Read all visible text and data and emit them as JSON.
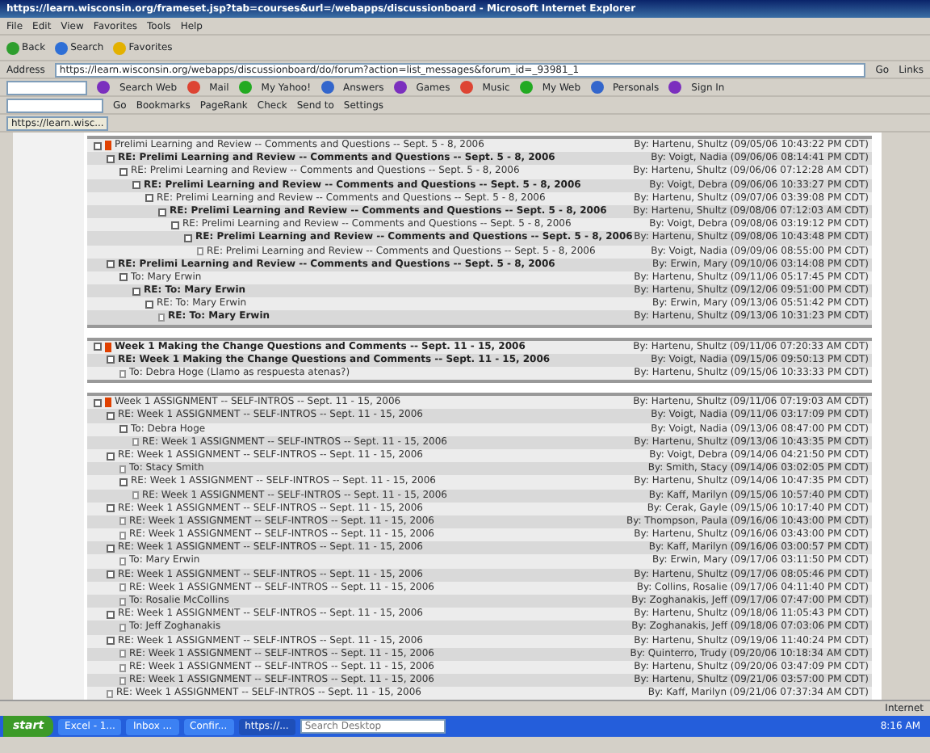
{
  "window": {
    "title": "https://learn.wisconsin.org/frameset.jsp?tab=courses&url=/webapps/discussionboard - Microsoft Internet Explorer"
  },
  "menu": [
    "File",
    "Edit",
    "View",
    "Favorites",
    "Tools",
    "Help"
  ],
  "toolbar": [
    "Back",
    "Search",
    "Favorites"
  ],
  "address": {
    "label": "Address",
    "value": "https://learn.wisconsin.org/webapps/discussionboard/do/forum?action=list_messages&forum_id=_93981_1",
    "go": "Go",
    "links": "Links"
  },
  "yahoo_bar": [
    "Search Web",
    "Mail",
    "My Yahoo!",
    "Answers",
    "Games",
    "Music",
    "My Web",
    "Personals",
    "Sign In"
  ],
  "google_bar": [
    "Go",
    "Bookmarks",
    "PageRank",
    "Check",
    "Send to",
    "Settings"
  ],
  "tab": {
    "label": "https://learn.wisc..."
  },
  "threads": [
    {
      "posts": [
        {
          "title": "Prelimi Learning and Review -- Comments and Questions -- Sept. 5 - 8, 2006",
          "author": "By: Hartenu, Shultz (09/05/06 10:43:22 PM CDT)",
          "flagged": true,
          "unread": false,
          "children": [
            {
              "title": "RE: Prelimi Learning and Review -- Comments and Questions -- Sept. 5 - 8, 2006",
              "author": "By: Voigt, Nadia (09/06/06 08:14:41 PM CDT)",
              "flagged": false,
              "unread": true,
              "children": [
                {
                  "title": "RE: Prelimi Learning and Review -- Comments and Questions -- Sept. 5 - 8, 2006",
                  "author": "By: Hartenu, Shultz (09/06/06 07:12:28 AM CDT)",
                  "flagged": false,
                  "unread": false,
                  "children": [
                    {
                      "title": "RE: Prelimi Learning and Review -- Comments and Questions -- Sept. 5 - 8, 2006",
                      "author": "By: Voigt, Debra (09/06/06 10:33:27 PM CDT)",
                      "flagged": false,
                      "unread": true,
                      "children": [
                        {
                          "title": "RE: Prelimi Learning and Review -- Comments and Questions -- Sept. 5 - 8, 2006",
                          "author": "By: Hartenu, Shultz (09/07/06 03:39:08 PM CDT)",
                          "flagged": false,
                          "unread": false,
                          "children": [
                            {
                              "title": "RE: Prelimi Learning and Review -- Comments and Questions -- Sept. 5 - 8, 2006",
                              "author": "By: Hartenu, Shultz (09/08/06 07:12:03 AM CDT)",
                              "flagged": false,
                              "unread": true,
                              "children": [
                                {
                                  "title": "RE: Prelimi Learning and Review -- Comments and Questions -- Sept. 5 - 8, 2006",
                                  "author": "By: Voigt, Debra (09/08/06 03:19:12 PM CDT)",
                                  "flagged": false,
                                  "unread": false,
                                  "children": [
                                    {
                                      "title": "RE: Prelimi Learning and Review -- Comments and Questions -- Sept. 5 - 8, 2006",
                                      "author": "By: Hartenu, Shultz (09/08/06 10:43:48 PM CDT)",
                                      "flagged": false,
                                      "unread": true,
                                      "children": [
                                        {
                                          "title": "RE: Prelimi Learning and Review -- Comments and Questions -- Sept. 5 - 8, 2006",
                                          "author": "By: Voigt, Nadia (09/09/06 08:55:00 PM CDT)",
                                          "flagged": false,
                                          "unread": false
                                        }
                                      ]
                                    }
                                  ]
                                }
                              ]
                            }
                          ]
                        }
                      ]
                    }
                  ]
                }
              ]
            },
            {
              "title": "RE: Prelimi Learning and Review -- Comments and Questions -- Sept. 5 - 8, 2006",
              "author": "By: Erwin, Mary (09/10/06 03:14:08 PM CDT)",
              "flagged": false,
              "unread": true,
              "children": [
                {
                  "title": "To: Mary Erwin",
                  "author": "By: Hartenu, Shultz (09/11/06 05:17:45 PM CDT)",
                  "flagged": false,
                  "unread": false,
                  "children": [
                    {
                      "title": "RE: To: Mary Erwin",
                      "author": "By: Hartenu, Shultz (09/12/06 09:51:00 PM CDT)",
                      "flagged": false,
                      "unread": true,
                      "children": [
                        {
                          "title": "RE: To: Mary Erwin",
                          "author": "By: Erwin, Mary (09/13/06 05:51:42 PM CDT)",
                          "flagged": false,
                          "unread": false,
                          "children": [
                            {
                              "title": "RE: To: Mary Erwin",
                              "author": "By: Hartenu, Shultz (09/13/06 10:31:23 PM CDT)",
                              "flagged": false,
                              "unread": true
                            }
                          ]
                        }
                      ]
                    }
                  ]
                }
              ]
            }
          ]
        }
      ]
    },
    {
      "posts": [
        {
          "title": "Week 1 Making the Change Questions and Comments -- Sept. 11 - 15, 2006",
          "author": "By: Hartenu, Shultz (09/11/06 07:20:33 AM CDT)",
          "flagged": true,
          "unread": true,
          "children": [
            {
              "title": "RE: Week 1 Making the Change Questions and Comments -- Sept. 11 - 15, 2006",
              "author": "By: Voigt, Nadia (09/15/06 09:50:13 PM CDT)",
              "flagged": false,
              "unread": true,
              "children": [
                {
                  "title": "To: Debra Hoge (Llamo as respuesta atenas?)",
                  "author": "By: Hartenu, Shultz (09/15/06 10:33:33 PM CDT)",
                  "flagged": false,
                  "unread": false
                }
              ]
            }
          ]
        }
      ]
    },
    {
      "posts": [
        {
          "title": "Week 1 ASSIGNMENT -- SELF-INTROS -- Sept. 11 - 15, 2006",
          "author": "By: Hartenu, Shultz (09/11/06 07:19:03 AM CDT)",
          "flagged": true,
          "unread": false,
          "children": [
            {
              "title": "RE: Week 1 ASSIGNMENT -- SELF-INTROS -- Sept. 11 - 15, 2006",
              "author": "By: Voigt, Nadia (09/11/06 03:17:09 PM CDT)",
              "flagged": false,
              "unread": false,
              "children": [
                {
                  "title": "To: Debra Hoge",
                  "author": "By: Voigt, Nadia (09/13/06 08:47:00 PM CDT)",
                  "flagged": false,
                  "unread": false,
                  "children": [
                    {
                      "title": "RE: Week 1 ASSIGNMENT -- SELF-INTROS -- Sept. 11 - 15, 2006",
                      "author": "By: Hartenu, Shultz (09/13/06 10:43:35 PM CDT)",
                      "flagged": false,
                      "unread": false
                    }
                  ]
                }
              ]
            },
            {
              "title": "RE: Week 1 ASSIGNMENT -- SELF-INTROS -- Sept. 11 - 15, 2006",
              "author": "By: Voigt, Debra (09/14/06 04:21:50 PM CDT)",
              "flagged": false,
              "unread": false,
              "children": [
                {
                  "title": "To: Stacy Smith",
                  "author": "By: Smith, Stacy (09/14/06 03:02:05 PM CDT)",
                  "flagged": false,
                  "unread": false
                },
                {
                  "title": "RE: Week 1 ASSIGNMENT -- SELF-INTROS -- Sept. 11 - 15, 2006",
                  "author": "By: Hartenu, Shultz (09/14/06 10:47:35 PM CDT)",
                  "flagged": false,
                  "unread": false,
                  "children": [
                    {
                      "title": "RE: Week 1 ASSIGNMENT -- SELF-INTROS -- Sept. 11 - 15, 2006",
                      "author": "By: Kaff, Marilyn (09/15/06 10:57:40 PM CDT)",
                      "flagged": false,
                      "unread": false
                    }
                  ]
                }
              ]
            },
            {
              "title": "RE: Week 1 ASSIGNMENT -- SELF-INTROS -- Sept. 11 - 15, 2006",
              "author": "By: Cerak, Gayle (09/15/06 10:17:40 PM CDT)",
              "flagged": false,
              "unread": false,
              "children": [
                {
                  "title": "RE: Week 1 ASSIGNMENT -- SELF-INTROS -- Sept. 11 - 15, 2006",
                  "author": "By: Thompson, Paula (09/16/06 10:43:00 PM CDT)",
                  "flagged": false,
                  "unread": false
                },
                {
                  "title": "RE: Week 1 ASSIGNMENT -- SELF-INTROS -- Sept. 11 - 15, 2006",
                  "author": "By: Hartenu, Shultz (09/16/06 03:43:00 PM CDT)",
                  "flagged": false,
                  "unread": false
                }
              ]
            },
            {
              "title": "RE: Week 1 ASSIGNMENT -- SELF-INTROS -- Sept. 11 - 15, 2006",
              "author": "By: Kaff, Marilyn (09/16/06 03:00:57 PM CDT)",
              "flagged": false,
              "unread": false,
              "children": [
                {
                  "title": "To: Mary Erwin",
                  "author": "By: Erwin, Mary (09/17/06 03:11:50 PM CDT)",
                  "flagged": false,
                  "unread": false
                }
              ]
            },
            {
              "title": "RE: Week 1 ASSIGNMENT -- SELF-INTROS -- Sept. 11 - 15, 2006",
              "author": "By: Hartenu, Shultz (09/17/06 08:05:46 PM CDT)",
              "flagged": false,
              "unread": false,
              "children": [
                {
                  "title": "RE: Week 1 ASSIGNMENT -- SELF-INTROS -- Sept. 11 - 15, 2006",
                  "author": "By: Collins, Rosalie (09/17/06 04:11:40 PM CDT)",
                  "flagged": false,
                  "unread": false
                },
                {
                  "title": "To: Rosalie McCollins",
                  "author": "By: Zoghanakis, Jeff (09/17/06 07:47:00 PM CDT)",
                  "flagged": false,
                  "unread": false
                }
              ]
            },
            {
              "title": "RE: Week 1 ASSIGNMENT -- SELF-INTROS -- Sept. 11 - 15, 2006",
              "author": "By: Hartenu, Shultz (09/18/06 11:05:43 PM CDT)",
              "flagged": false,
              "unread": false,
              "children": [
                {
                  "title": "To: Jeff Zoghanakis",
                  "author": "By: Zoghanakis, Jeff (09/18/06 07:03:06 PM CDT)",
                  "flagged": false,
                  "unread": false
                }
              ]
            },
            {
              "title": "RE: Week 1 ASSIGNMENT -- SELF-INTROS -- Sept. 11 - 15, 2006",
              "author": "By: Hartenu, Shultz (09/19/06 11:40:24 PM CDT)",
              "flagged": false,
              "unread": false,
              "children": [
                {
                  "title": "RE: Week 1 ASSIGNMENT -- SELF-INTROS -- Sept. 11 - 15, 2006",
                  "author": "By: Quinterro, Trudy (09/20/06 10:18:34 AM CDT)",
                  "flagged": false,
                  "unread": false
                },
                {
                  "title": "RE: Week 1 ASSIGNMENT -- SELF-INTROS -- Sept. 11 - 15, 2006",
                  "author": "By: Hartenu, Shultz (09/20/06 03:47:09 PM CDT)",
                  "flagged": false,
                  "unread": false
                },
                {
                  "title": "RE: Week 1 ASSIGNMENT -- SELF-INTROS -- Sept. 11 - 15, 2006",
                  "author": "By: Hartenu, Shultz (09/21/06 03:57:00 PM CDT)",
                  "flagged": false,
                  "unread": false
                }
              ]
            },
            {
              "title": "RE: Week 1 ASSIGNMENT -- SELF-INTROS -- Sept. 11 - 15, 2006",
              "author": "By: Kaff, Marilyn (09/21/06 07:37:34 AM CDT)",
              "flagged": false,
              "unread": false
            }
          ]
        }
      ]
    }
  ],
  "status_bar": {
    "zone": "Internet"
  },
  "taskbar": {
    "start": "start",
    "tasks": [
      {
        "label": "Excel - 1...",
        "selected": false
      },
      {
        "label": "Inbox ...",
        "selected": false
      },
      {
        "label": "Confir...",
        "selected": false
      },
      {
        "label": "https://...",
        "selected": true
      }
    ],
    "search_placeholder": "Search Desktop",
    "clock": "8:16 AM"
  }
}
